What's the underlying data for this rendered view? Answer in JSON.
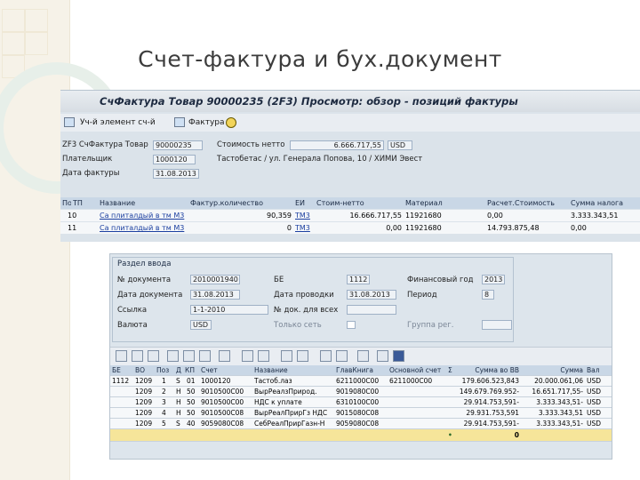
{
  "slide": {
    "title": "Счет-фактура и бух.документ"
  },
  "top_window": {
    "title": "СчФактура Товар 90000235   (2F3) Просмотр: обзор - позиций фактуры",
    "toolbar": [
      "Уч-й элемент сч-й",
      "Фактура"
    ],
    "header_fields": [
      {
        "label": "ZF3 СчФактура Товар",
        "value": "90000235"
      },
      {
        "label": "Плательщик",
        "value": "1000120"
      },
      {
        "label": "Дата фактуры",
        "value": "31.08.2013"
      }
    ],
    "net_value": {
      "label": "Стоимость нетто",
      "value": "6.666.717,55",
      "currency": "USD"
    },
    "payer_text": "Тастобетас / ул. Генерала Попова, 10 / ХИМИ Эвест",
    "columns": [
      "Поз",
      "ТП",
      "Название",
      "Фактур.количество",
      "ЕИ",
      "Стоим-нетто",
      "Материал",
      "Расчет.Стоимость",
      "Сумма налога"
    ],
    "rows": [
      [
        "10",
        "",
        "Са плиталдый в тм М3",
        "90,359",
        "ТМ3",
        "16.666.717,55",
        "11921680",
        "0,00",
        "3.333.343,51"
      ],
      [
        "11",
        "",
        "Са плиталдый в тм М3",
        "0",
        "ТМ3",
        "0,00",
        "11921680",
        "14.793.875,48",
        "0,00"
      ]
    ]
  },
  "bottom_window": {
    "frame_title": "Раздел ввода",
    "fields_left": [
      {
        "label": "№ документа",
        "value": "2010001940"
      },
      {
        "label": "Дата документа",
        "value": "31.08.2013"
      },
      {
        "label": "Ссылка",
        "value": "1-1-2010"
      },
      {
        "label": "Валюта",
        "value": "USD"
      }
    ],
    "fields_mid": [
      {
        "label": "БЕ",
        "value": "1112"
      },
      {
        "label": "Дата проводки",
        "value": "31.08.2013"
      },
      {
        "label": "№ док. для всех",
        "value": ""
      },
      {
        "label": "Только сеть",
        "value": ""
      }
    ],
    "fields_right": [
      {
        "label": "Финансовый год",
        "value": "2013"
      },
      {
        "label": "Период",
        "value": "8"
      },
      {
        "label": "Группа рег.",
        "value": ""
      }
    ],
    "columns": [
      "БЕ",
      "ВО",
      "Поз",
      "Д",
      "КП",
      "Счет",
      "Название",
      "ГлавКнига",
      "Основной счет",
      "Σ",
      "Сумма во ВВ",
      "Сумма",
      "Вал"
    ],
    "rows": [
      [
        "1112",
        "1209",
        "1",
        "S",
        "01",
        "1000120",
        "Тастоб.лаз",
        "6211000C00",
        "6211000C00",
        "",
        "179.606.523,843",
        "20.000.061,06",
        "USD"
      ],
      [
        "",
        "1209",
        "2",
        "H",
        "50",
        "9010500C00",
        "ВырРеалзПрирод.",
        "9019080C00",
        "",
        "",
        "149.679.769.952-",
        "16.651.717,55-",
        "USD"
      ],
      [
        "",
        "1209",
        "3",
        "H",
        "50",
        "9010500C00",
        "НДС к уплате",
        "6310100C00",
        "",
        "",
        "29.914.753,591-",
        "3.333.343,51-",
        "USD"
      ],
      [
        "",
        "1209",
        "4",
        "H",
        "50",
        "9010500C08",
        "ВырРеалПрирГз НДС",
        "9015080C08",
        "",
        "",
        "29.931.753,591",
        "3.333.343,51",
        "USD"
      ],
      [
        "",
        "1209",
        "5",
        "S",
        "40",
        "9059080C08",
        "СебРеалПрирГазн-Н",
        "9059080C08",
        "",
        "",
        "29.914.753,591-",
        "3.333.343,51-",
        "USD"
      ]
    ],
    "total": {
      "dot": "•",
      "value": "0"
    }
  }
}
